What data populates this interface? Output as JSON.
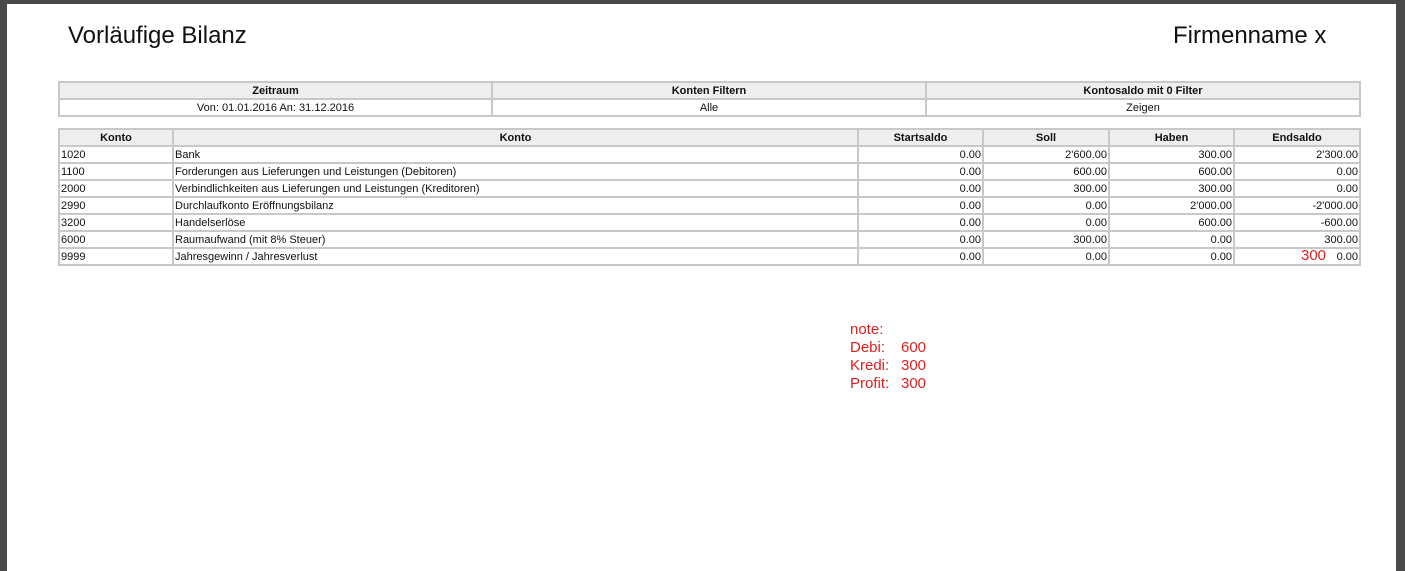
{
  "header": {
    "title": "Vorläufige Bilanz",
    "company": "Firmenname x"
  },
  "filters": {
    "headers": [
      "Zeitraum",
      "Konten Filtern",
      "Kontosaldo mit 0 Filter"
    ],
    "values": [
      "Von: 01.01.2016 An: 31.12.2016",
      "Alle",
      "Zeigen"
    ]
  },
  "table": {
    "headers": [
      "Konto",
      "Konto",
      "Startsaldo",
      "Soll",
      "Haben",
      "Endsaldo"
    ],
    "rows": [
      [
        "1020",
        "Bank",
        "0.00",
        "2'600.00",
        "300.00",
        "2'300.00"
      ],
      [
        "1100",
        "Forderungen aus Lieferungen und Leistungen (Debitoren)",
        "0.00",
        "600.00",
        "600.00",
        "0.00"
      ],
      [
        "2000",
        "Verbindlichkeiten aus Lieferungen und Leistungen (Kreditoren)",
        "0.00",
        "300.00",
        "300.00",
        "0.00"
      ],
      [
        "2990",
        "Durchlaufkonto Eröffnungsbilanz",
        "0.00",
        "0.00",
        "2'000.00",
        "-2'000.00"
      ],
      [
        "3200",
        "Handelserlöse",
        "0.00",
        "0.00",
        "600.00",
        "-600.00"
      ],
      [
        "6000",
        "Raumaufwand (mit 8% Steuer)",
        "0.00",
        "300.00",
        "0.00",
        "300.00"
      ],
      [
        "9999",
        "Jahresgewinn / Jahresverlust",
        "0.00",
        "0.00",
        "0.00",
        "0.00"
      ]
    ]
  },
  "annotation": {
    "inline_mark": "300",
    "note_title": "note:",
    "lines": [
      {
        "label": "Debi:",
        "value": "600"
      },
      {
        "label": "Kredi:",
        "value": "300"
      },
      {
        "label": "Profit:",
        "value": "300"
      }
    ],
    "color": "#e02020"
  }
}
